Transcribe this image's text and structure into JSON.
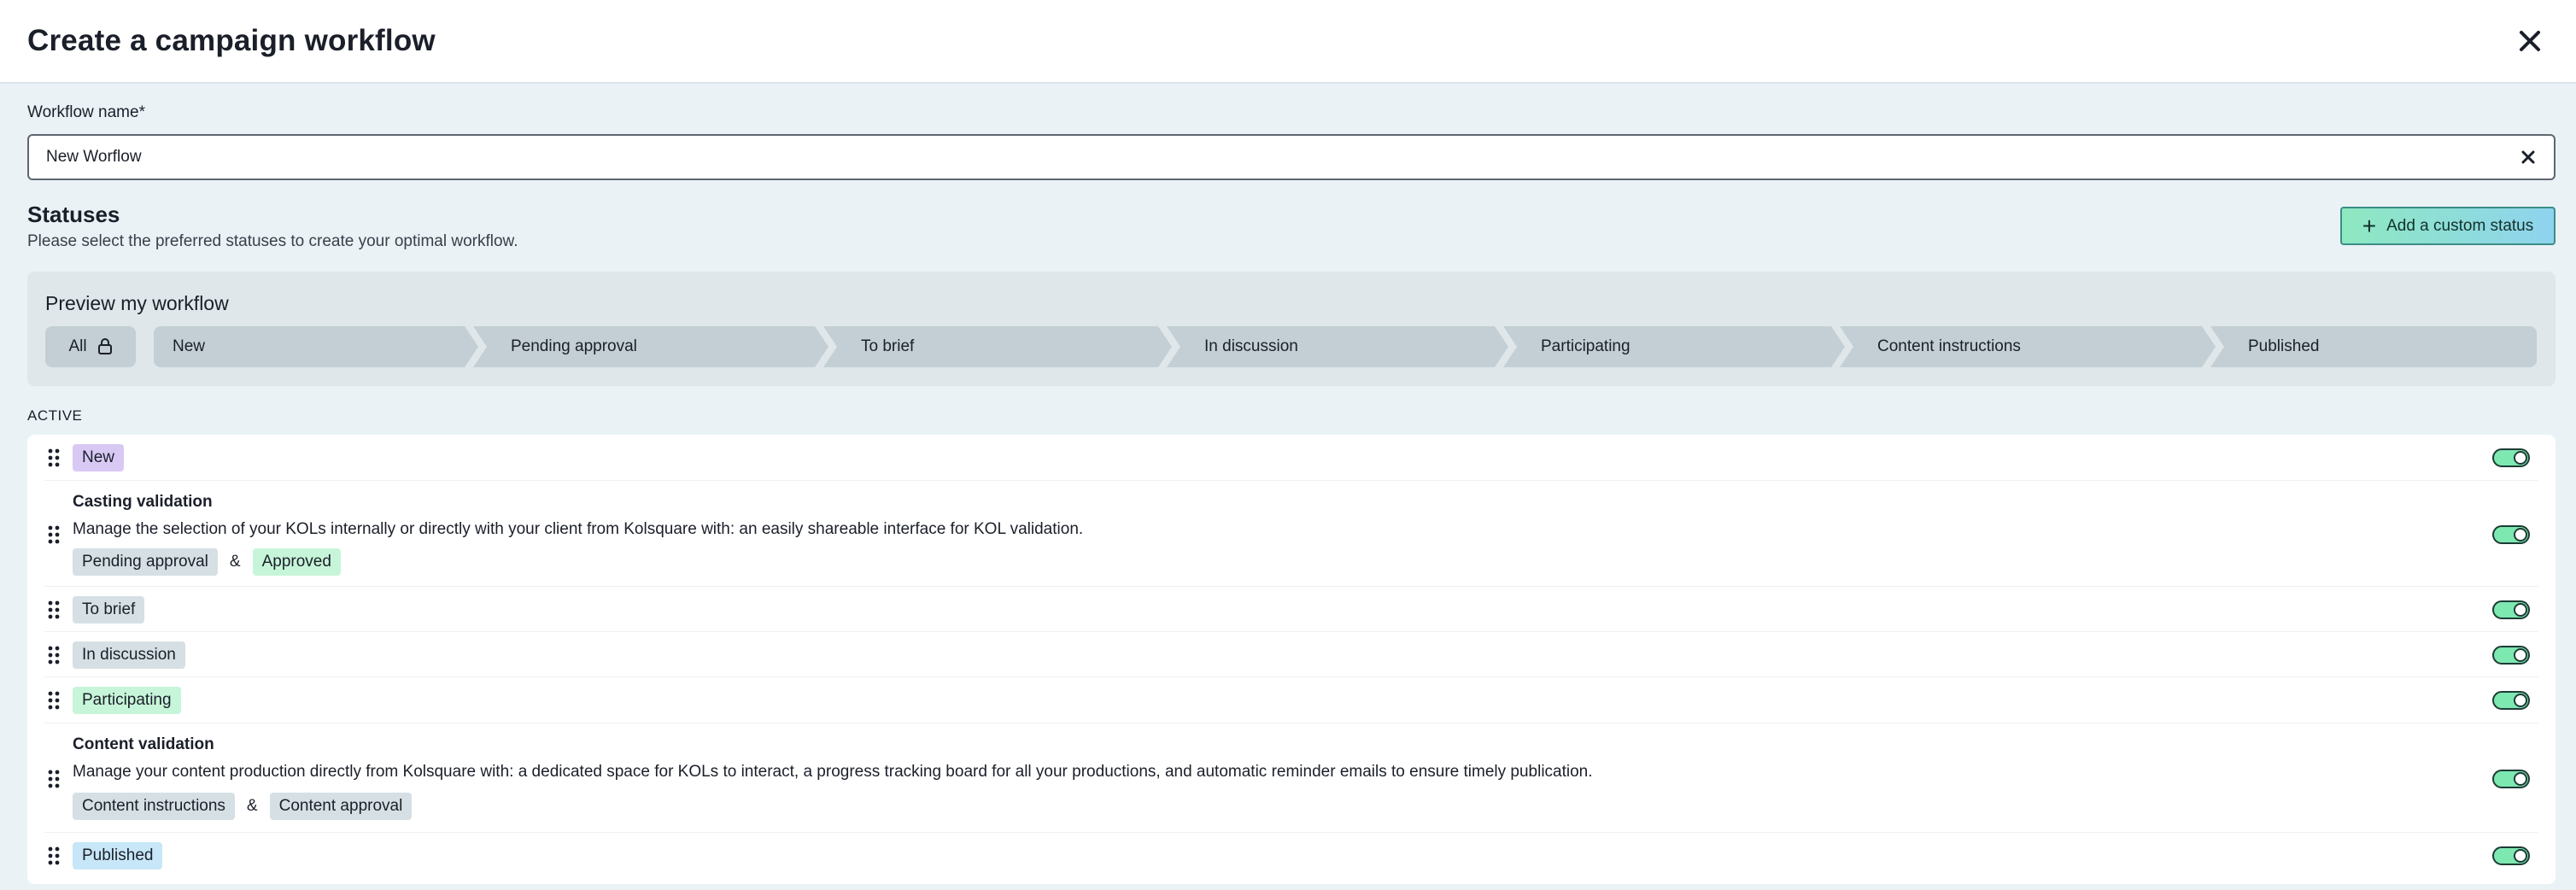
{
  "header": {
    "title": "Create a campaign workflow"
  },
  "workflow_name": {
    "label": "Workflow name*",
    "value": "New Worflow"
  },
  "statuses": {
    "title": "Statuses",
    "subtitle": "Please select the preferred statuses to create your optimal workflow.",
    "add_button_label": "Add a custom status"
  },
  "preview": {
    "title": "Preview my workflow",
    "all_label": "All",
    "steps": [
      "New",
      "Pending approval",
      "To brief",
      "In discussion",
      "Participating",
      "Content instructions",
      "Published"
    ]
  },
  "active": {
    "label": "ACTIVE",
    "rows": [
      {
        "tag": "New",
        "tag_color": "#d8c9f4",
        "enabled": true
      },
      {
        "title": "Casting validation",
        "description": "Manage the selection of your KOLs internally or directly with your client from Kolsquare with: an easily shareable interface for KOL validation.",
        "tags": [
          "Pending approval",
          "Approved"
        ],
        "joiner": "&",
        "enabled": true
      },
      {
        "tag": "To brief",
        "tag_color": "#d6e0e4",
        "enabled": true
      },
      {
        "tag": "In discussion",
        "tag_color": "#d6e0e4",
        "enabled": true
      },
      {
        "tag": "Participating",
        "tag_color": "#c7f5d9",
        "enabled": true
      },
      {
        "title": "Content validation",
        "description": "Manage your content production directly from Kolsquare with: a dedicated space for KOLs to interact, a progress tracking board for all your productions, and automatic reminder emails to ensure timely publication.",
        "tags": [
          "Content instructions",
          "Content approval"
        ],
        "joiner": "&",
        "enabled": true
      },
      {
        "tag": "Published",
        "tag_color": "#c7e6f7",
        "enabled": true
      }
    ]
  },
  "icons": {
    "close": "close-icon",
    "clear": "clear-icon",
    "plus": "plus-icon",
    "lock": "lock-icon",
    "drag": "drag-handle-icon"
  },
  "colors": {
    "accent_green": "#7de8b0",
    "accent_blue": "#8fd3ef",
    "background": "#eaf2f6"
  }
}
